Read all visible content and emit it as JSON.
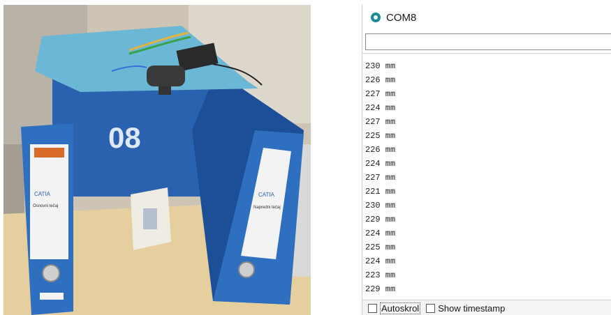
{
  "photo": {
    "box_number": "08",
    "binder_brand": "CATIA",
    "left_binder_label": "Osnovni tečaj",
    "right_binder_label": "Napredni tečaj",
    "colors": {
      "binder_blue": "#2f6fc0",
      "binder_dark": "#1d4f98",
      "mat": "#6ab7d6",
      "table": "#e6cf9e",
      "wall": "#cdc4b5"
    }
  },
  "window": {
    "title": "COM8",
    "icon": "arduino-icon",
    "accent_color": "#1b8c96"
  },
  "send_input": {
    "value": "",
    "placeholder": ""
  },
  "readings": [
    "230 mm",
    "226 mm",
    "227 mm",
    "224 mm",
    "227 mm",
    "225 mm",
    "226 mm",
    "224 mm",
    "227 mm",
    "221 mm",
    "230 mm",
    "229 mm",
    "224 mm",
    "225 mm",
    "224 mm",
    "223 mm",
    "229 mm"
  ],
  "statusbar": {
    "autoscroll_label": "Autoskrol",
    "autoscroll_checked": false,
    "timestamp_label": "Show timestamp",
    "timestamp_checked": false
  }
}
